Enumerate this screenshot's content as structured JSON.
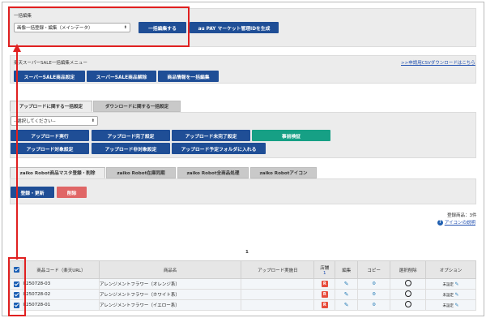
{
  "bulk_edit": {
    "title": "一括編集",
    "select_value": "画像一括登録・編集（メインデータ）",
    "bulk_edit_button": "一括編集する",
    "au_button": "au PAY マーケット管理IDを生成"
  },
  "rakuten": {
    "title": "楽天スーパーSALE一括編集メニュー",
    "csv_link": ">>申請用CSVダウンロードはこちら",
    "btn_set": "スーパーSALE商品設定",
    "btn_unset": "スーパーSALE商品解除",
    "btn_info": "商品情報を一括編集"
  },
  "upload": {
    "tab_upload": "アップロードに関する一括設定",
    "tab_download": "ダウンロードに関する一括設定",
    "select_placeholder": "--選択してください--",
    "buttons_row1": [
      "アップロード実行",
      "アップロード完了設定",
      "アップロード未完了設定",
      "事前検証"
    ],
    "buttons_row2": [
      "アップロード対象設定",
      "アップロード非対象設定",
      "アップロード予定フォルダに入れる"
    ]
  },
  "zaiko": {
    "tabs": [
      "zaiko Robot商品マスタ登録・削除",
      "zaiko Robot在庫同期",
      "zaiko Robot全商品処理",
      "zaiko Robotアイコン"
    ],
    "btn_register": "登録・更新",
    "btn_delete": "削除"
  },
  "summary": {
    "count": "登録商品：3件",
    "icon_help": "アイコンの説明",
    "page": "1"
  },
  "table": {
    "headers": {
      "code": "商品コード（楽天URL）",
      "name": "商品名",
      "upload_date": "アップロード実施日",
      "shop": "店舗",
      "shop_count": "1",
      "edit": "編集",
      "copy": "コピー",
      "select": "選択削除",
      "option": "オプション"
    },
    "rows": [
      {
        "code": "k250728-03",
        "name": "アレンジメントフラワー（オレンジ系）",
        "shop": "R",
        "status": "未設定"
      },
      {
        "code": "k250728-02",
        "name": "アレンジメントフラワー（ホワイト系）",
        "shop": "R",
        "status": "未設定"
      },
      {
        "code": "k250728-01",
        "name": "アレンジメントフラワー（イエロー系）",
        "shop": "R",
        "status": "未設定"
      }
    ]
  },
  "colors": {
    "primary": "#1f4e96",
    "green": "#16a085",
    "danger": "#e06666",
    "annotation": "#e02020"
  }
}
